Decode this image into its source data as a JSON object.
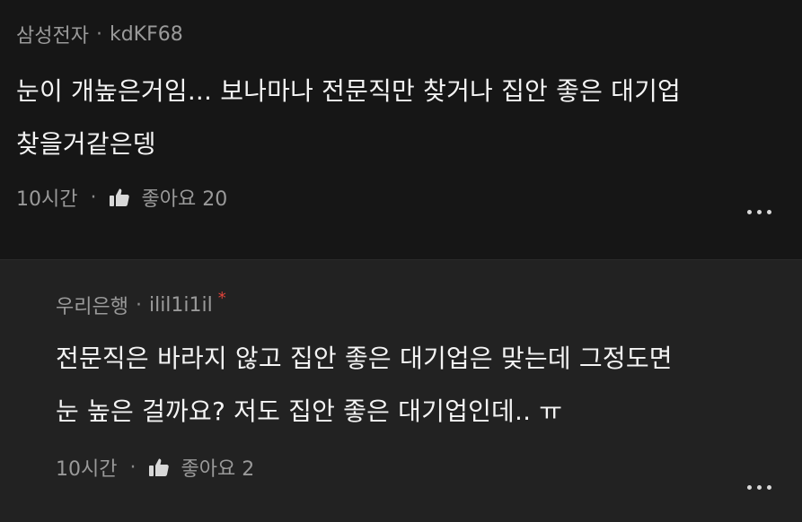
{
  "comment": {
    "company": "삼성전자",
    "separator": "·",
    "username": "kdKF68",
    "text": "눈이 개높은거임... 보나마나 전문직만 찾거나 집안 좋은 대기업\n찾을거같은뎅",
    "time": "10시간",
    "like_label": "좋아요 20"
  },
  "reply": {
    "company": "우리은행",
    "separator": "·",
    "username": "ilil1i1il",
    "author_mark": "*",
    "text": "전문직은 바라지 않고 집안 좋은 대기업은 맞는데 그정도면\n눈 높은 걸까요? 저도 집안 좋은 대기업인데.. ㅠ",
    "time": "10시간",
    "like_label": "좋아요 2"
  },
  "footer_separator": "·",
  "icons": {
    "like": "thumbs-up-icon",
    "more": "more-dots-icon"
  },
  "colors": {
    "background": "#161616",
    "reply_background": "#222222",
    "meta_text": "#9a9a9a",
    "body_text": "#f4f4f4",
    "author_mark": "#e0433a"
  }
}
